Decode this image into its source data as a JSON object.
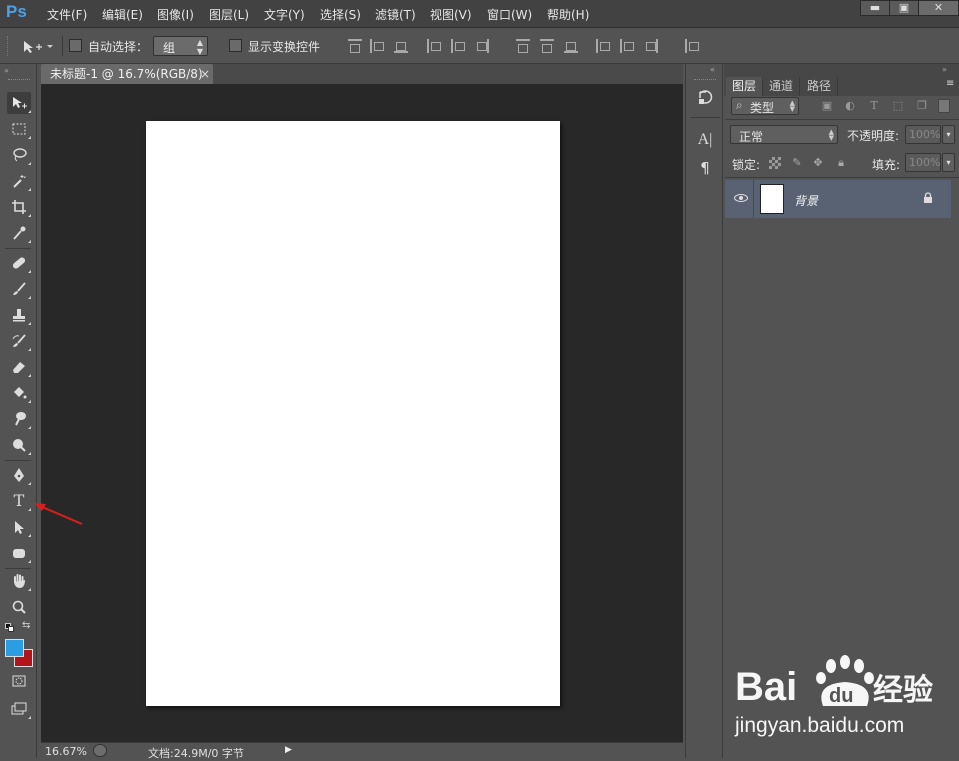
{
  "app": {
    "logo_text": "Ps"
  },
  "menu": [
    "文件(F)",
    "编辑(E)",
    "图像(I)",
    "图层(L)",
    "文字(Y)",
    "选择(S)",
    "滤镜(T)",
    "视图(V)",
    "窗口(W)",
    "帮助(H)"
  ],
  "window_controls": {
    "minimize": "▬",
    "maximize": "▣",
    "close": "✕"
  },
  "options": {
    "auto_select_label": "自动选择：",
    "auto_select_value": "组",
    "show_transform_label": "显示变换控件"
  },
  "document": {
    "tab_title": "未标题-1 @ 16.7%(RGB/8)",
    "tab_close": "×",
    "zoom": "16.67%",
    "doc_info": "文档:24.9M/0 字节"
  },
  "colors": {
    "foreground": "#2a9de3",
    "background": "#b3131b"
  },
  "panels": {
    "tabs": [
      "图层",
      "通道",
      "路径"
    ],
    "active_tab": "图层",
    "filter_kind": "类型",
    "blend_mode": "正常",
    "opacity_label": "不透明度:",
    "opacity_value": "100%",
    "lock_label": "锁定:",
    "fill_label": "填充:",
    "fill_value": "100%",
    "layers": [
      {
        "name": "背景",
        "visible": true,
        "locked": true
      }
    ]
  },
  "watermark": {
    "brand_text": "Bai du 经验",
    "url": "jingyan.baidu.com"
  }
}
